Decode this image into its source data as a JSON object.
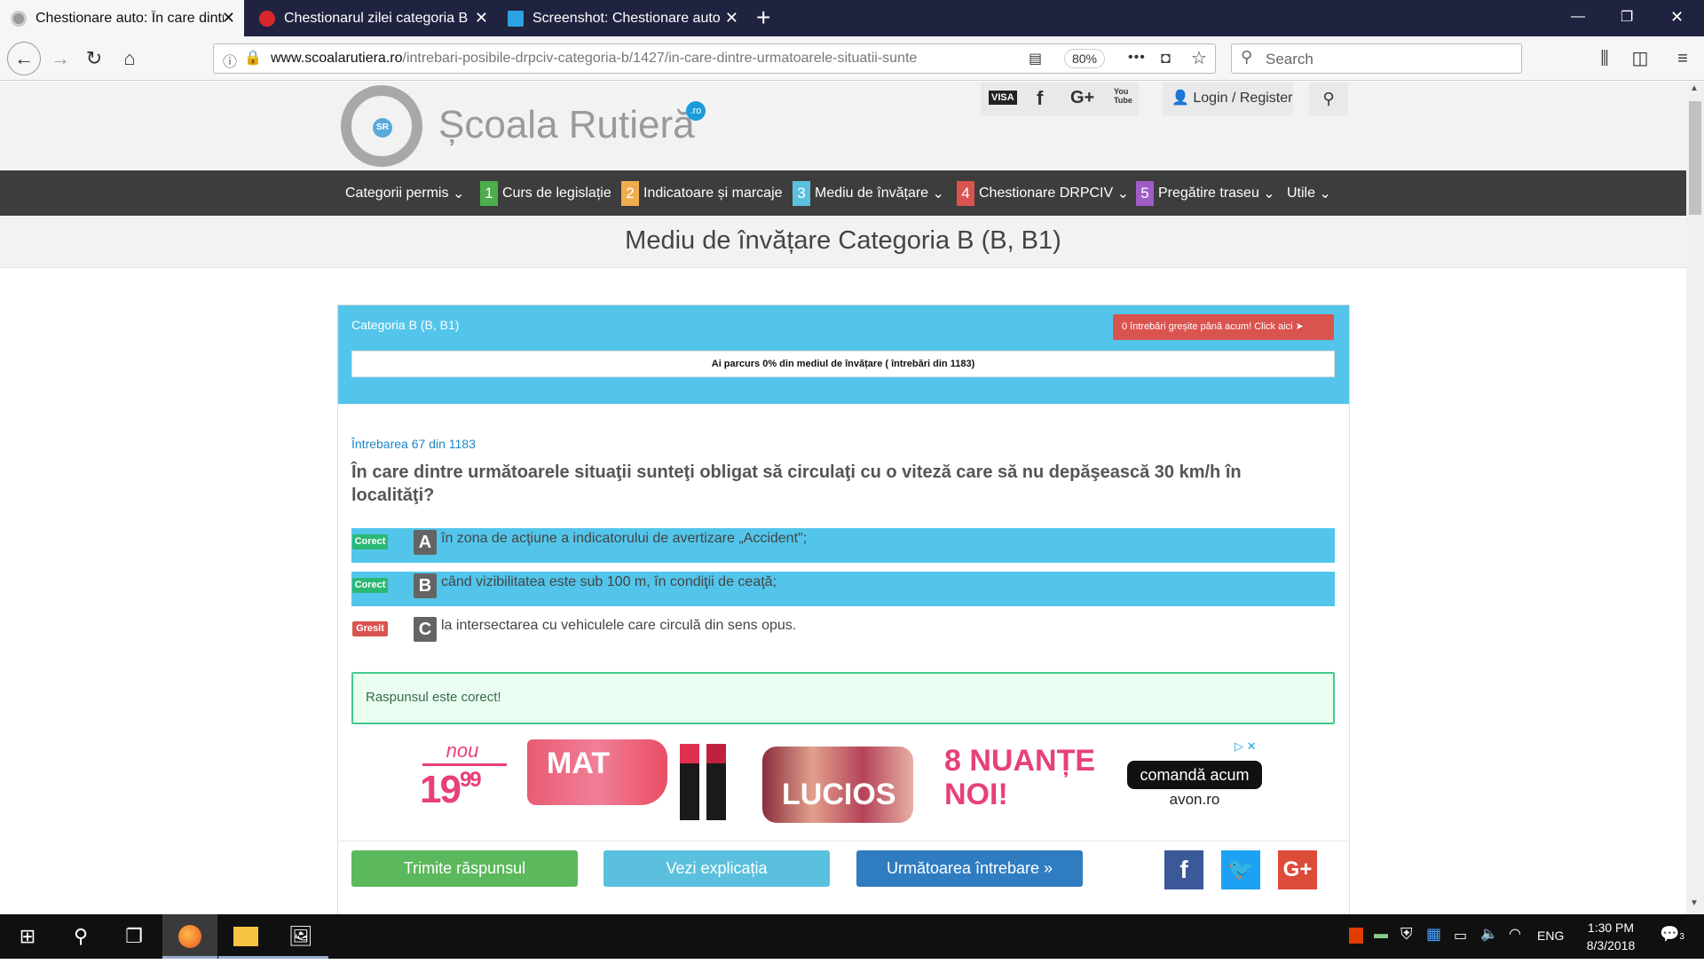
{
  "browser": {
    "tabs": [
      {
        "title": "Chestionare auto: În care dintre următoarele",
        "close": "✕",
        "icon": "steering-wheel-icon"
      },
      {
        "title": "Chestionarul zilei categoria B - Cu",
        "close": "✕",
        "icon": "stop-sign-icon"
      },
      {
        "title": "Screenshot: Chestionare auto: Î",
        "close": "✕",
        "icon": "scissors-icon"
      }
    ],
    "new_tab": "+",
    "window_controls": {
      "minimize": "—",
      "restore": "❐",
      "close": "✕"
    },
    "url_domain": "www.scoalarutiera.ro",
    "url_path": "/intrebari-posibile-drpciv-categoria-b/1427/in-care-dintre-urmatoarele-situatii-sunte",
    "zoom": "80%",
    "more": "•••",
    "search_placeholder": "Search"
  },
  "site": {
    "logo_text": "Școala Rutieră",
    "logo_badge": "SR",
    "logo_tld": ".ro",
    "social": {
      "visa": "VISA",
      "facebook": "f",
      "google": "G+",
      "youtube": "You Tube"
    },
    "login": "Login / Register",
    "menu": [
      {
        "label": "Categorii permis",
        "dropdown": "⌄"
      },
      {
        "num": "1",
        "label": "Curs de legislație",
        "color": "#4cae4c"
      },
      {
        "num": "2",
        "label": "Indicatoare și marcaje",
        "color": "#f0ad4e"
      },
      {
        "num": "3",
        "label": "Mediu de învățare",
        "color": "#5bc0de",
        "dropdown": "⌄"
      },
      {
        "num": "4",
        "label": "Chestionare DRPCIV",
        "color": "#d9534f",
        "dropdown": "⌄"
      },
      {
        "num": "5",
        "label": "Pregătire traseu",
        "color": "#a05cc6",
        "dropdown": "⌄"
      },
      {
        "label": "Utile",
        "dropdown": "⌄"
      }
    ],
    "page_title": "Mediu de învățare Categoria B (B, B1)"
  },
  "quiz": {
    "category": "Categoria B (B, B1)",
    "wrong_button": "0 întrebări greșite până acum! Click aici",
    "progress_text": "Ai parcurs 0% din mediul de învățare ( întrebări din 1183)",
    "progress_fraction": 0,
    "question_counter": "Întrebarea 67 din 1183",
    "question": "În care dintre următoarele situaţii sunteţi obligat să circulaţi cu o viteză care să nu depăşească 30 km/h în localităţi?",
    "answers": [
      {
        "badge": "Corect",
        "letter": "A",
        "text": "în zona de acţiune a indicatorului de avertizare „Accident\";",
        "correct": true
      },
      {
        "badge": "Corect",
        "letter": "B",
        "text": "când vizibilitatea este sub 100 m, în condiţii de ceaţă;",
        "correct": true
      },
      {
        "badge": "Gresit",
        "letter": "C",
        "text": "la intersectarea cu vehiculele care circulă din sens opus.",
        "correct": false
      }
    ],
    "result": "Raspunsul este corect!",
    "buttons": {
      "submit": "Trimite răspunsul",
      "explain": "Vezi explicația",
      "next": "Următoarea întrebare »"
    },
    "share": {
      "facebook": "f",
      "twitter": "🐦",
      "google": "G+"
    }
  },
  "ad": {
    "nou": "nou",
    "price": "19",
    "price_cents": "99",
    "mat": "MAT",
    "lucios": "LUCIOS",
    "nuante_1": "8 NUANȚE",
    "nuante_2": "NOI!",
    "cta": "comandă acum",
    "site": "avon.ro",
    "adchoices": "▷ ✕"
  },
  "taskbar": {
    "language": "ENG",
    "time": "1:30 PM",
    "date": "8/3/2018",
    "notifications": "3"
  }
}
